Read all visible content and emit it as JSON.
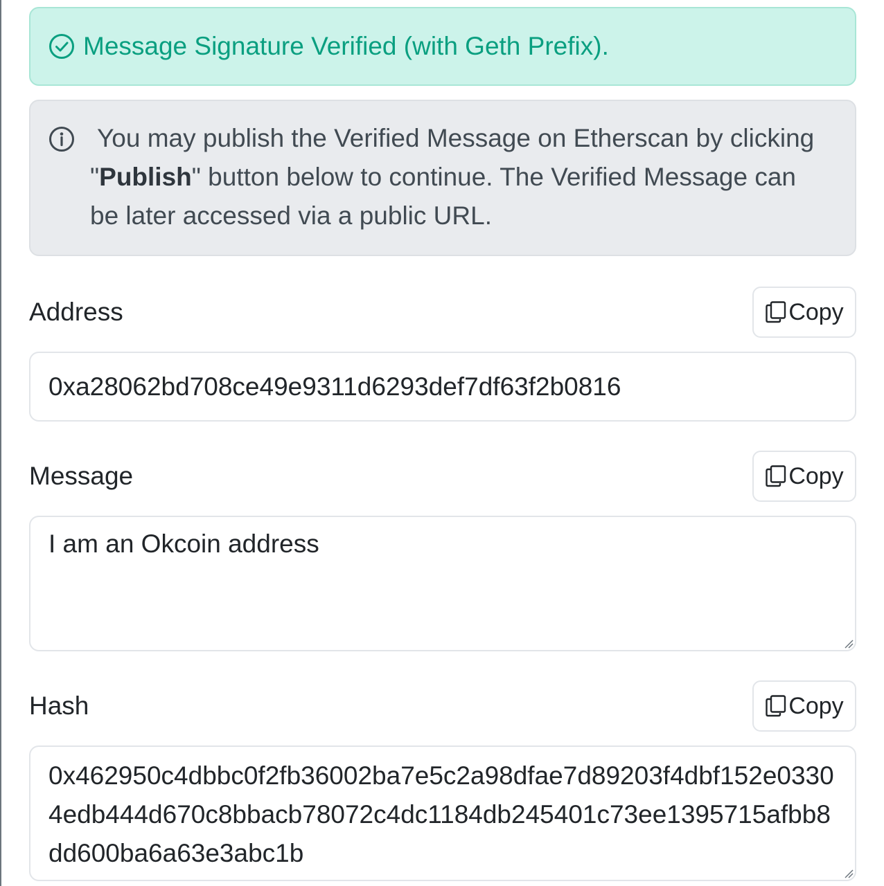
{
  "success_alert": {
    "icon": "check-circle-icon",
    "text": "Message Signature Verified (with Geth Prefix).",
    "color": "#0a9f80",
    "background": "#ccf3ea"
  },
  "info_alert": {
    "icon": "info-circle-icon",
    "text_before": "You may publish the Verified Message on Etherscan by clicking \"",
    "text_bold": "Publish",
    "text_after": "\" button below to continue. The Verified Message can be later accessed via a public URL.",
    "background": "#e9ebee"
  },
  "address": {
    "label": "Address",
    "copy_label": "Copy",
    "value": "0xa28062bd708ce49e9311d6293def7df63f2b0816"
  },
  "message": {
    "label": "Message",
    "copy_label": "Copy",
    "value": "I am an Okcoin address"
  },
  "hash": {
    "label": "Hash",
    "copy_label": "Copy",
    "value": "0x462950c4dbbc0f2fb36002ba7e5c2a98dfae7d89203f4dbf152e03304edb444d670c8bbacb78072c4dc1184db245401c73ee1395715afbb8dd600ba6a63e3abc1b"
  }
}
